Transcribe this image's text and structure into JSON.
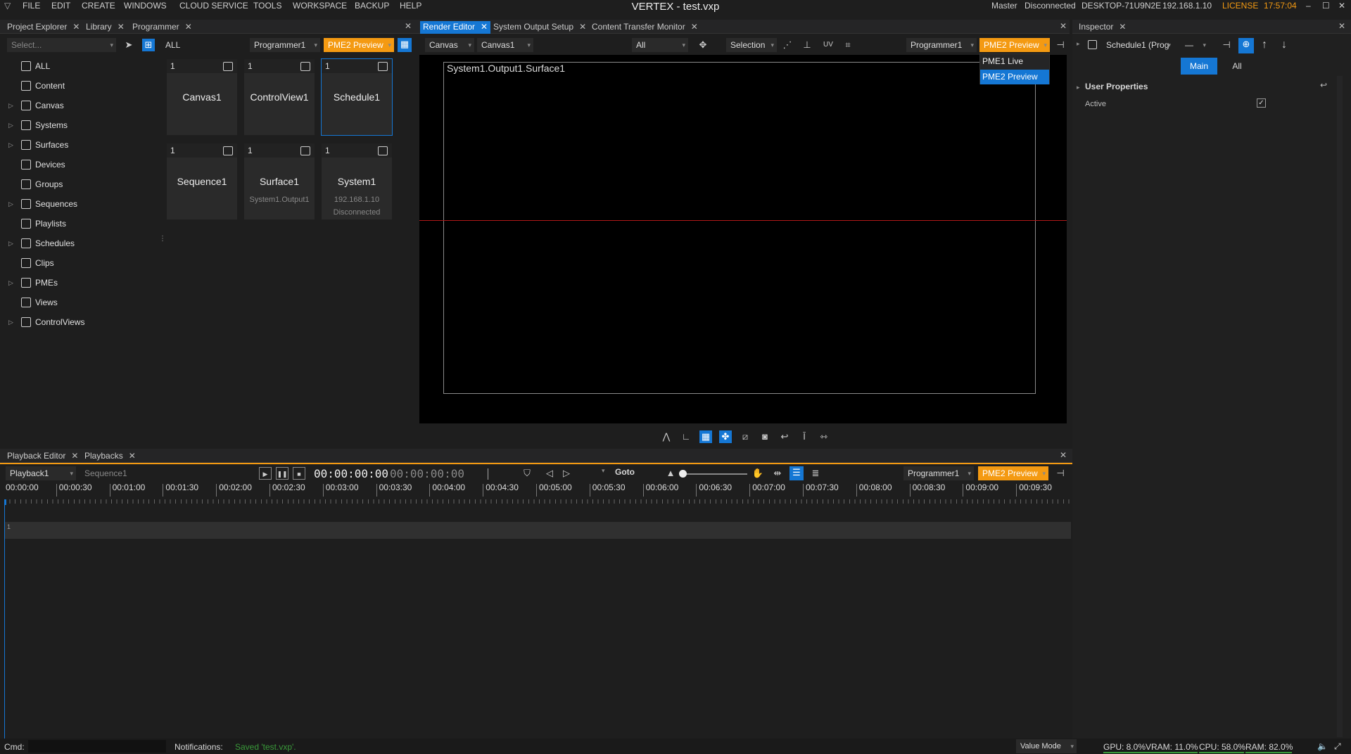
{
  "menubar": {
    "items": [
      "FILE",
      "EDIT",
      "CREATE",
      "WINDOWS",
      "CLOUD SERVICE",
      "TOOLS",
      "WORKSPACE",
      "BACKUP",
      "HELP"
    ],
    "title": "VERTEX - test.vxp",
    "status": [
      "Master",
      "Disconnected",
      "DESKTOP-71U9N2E",
      "192.168.1.10"
    ],
    "license": "LICENSE",
    "clock": "17:57:04"
  },
  "left_tabs": [
    "Project Explorer",
    "Library",
    "Programmer"
  ],
  "project_explorer": {
    "select_placeholder": "Select...",
    "tree": [
      {
        "label": "ALL",
        "expandable": false
      },
      {
        "label": "Content",
        "expandable": false
      },
      {
        "label": "Canvas",
        "expandable": true
      },
      {
        "label": "Systems",
        "expandable": true
      },
      {
        "label": "Surfaces",
        "expandable": true
      },
      {
        "label": "Devices",
        "expandable": false
      },
      {
        "label": "Groups",
        "expandable": false
      },
      {
        "label": "Sequences",
        "expandable": true
      },
      {
        "label": "Playlists",
        "expandable": false
      },
      {
        "label": "Schedules",
        "expandable": true
      },
      {
        "label": "Clips",
        "expandable": false
      },
      {
        "label": "PMEs",
        "expandable": true
      },
      {
        "label": "Views",
        "expandable": false
      },
      {
        "label": "ControlViews",
        "expandable": true
      }
    ]
  },
  "programmer": {
    "filter": "ALL",
    "programmer_select": "Programmer1",
    "pme_select": "PME2 Preview",
    "tiles": [
      {
        "num": "1",
        "name": "Canvas1",
        "sub": "",
        "sub2": "",
        "icon": "canvas-icon"
      },
      {
        "num": "1",
        "name": "ControlView1",
        "sub": "",
        "sub2": "",
        "icon": "sliders-icon"
      },
      {
        "num": "1",
        "name": "Schedule1",
        "sub": "",
        "sub2": "",
        "icon": "calendar-icon"
      },
      {
        "num": "1",
        "name": "Sequence1",
        "sub": "",
        "sub2": "",
        "icon": "sequence-icon"
      },
      {
        "num": "1",
        "name": "Surface1",
        "sub": "System1.Output1",
        "sub2": "",
        "icon": "surface-icon"
      },
      {
        "num": "1",
        "name": "System1",
        "sub": "192.168.1.10",
        "sub2": "Disconnected",
        "icon": "server-icon"
      }
    ]
  },
  "center_tabs": [
    "Render Editor",
    "System Output Setup",
    "Content Transfer Monitor"
  ],
  "render_editor": {
    "canvas_type": "Canvas",
    "canvas_select": "Canvas1",
    "filter_select": "All",
    "selection_select": "Selection",
    "programmer_select": "Programmer1",
    "pme_select": "PME2 Preview",
    "pme_options": [
      "PME1 Live",
      "PME2 Preview"
    ],
    "surface_label": "System1.Output1.Surface1"
  },
  "inspector": {
    "tab": "Inspector",
    "object": "Schedule1 (Prog",
    "minus": "—",
    "main_tab": "Main",
    "all_tab": "All",
    "section": "User Properties",
    "prop_active": "Active"
  },
  "bottom_tabs": [
    "Playback Editor",
    "Playbacks"
  ],
  "playback": {
    "playback_select": "Playback1",
    "sequence_select": "Sequence1",
    "time_current": "00:00:00:00",
    "time_total": "00:00:00:00",
    "goto": "Goto",
    "programmer_select": "Programmer1",
    "pme_select": "PME2 Preview",
    "ruler": [
      "00:00:00",
      "00:00:30",
      "00:01:00",
      "00:01:30",
      "00:02:00",
      "00:02:30",
      "00:03:00",
      "00:03:30",
      "00:04:00",
      "00:04:30",
      "00:05:00",
      "00:05:30",
      "00:06:00",
      "00:06:30",
      "00:07:00",
      "00:07:30",
      "00:08:00",
      "00:08:30",
      "00:09:00",
      "00:09:30"
    ],
    "track_num": "1"
  },
  "statusbar": {
    "cmd": "Cmd:",
    "notifications": "Notifications:",
    "notification_msg": "Saved 'test.vxp'.",
    "mode": "Value Mode",
    "gpu": "GPU: 8.0%",
    "vram": "VRAM: 11.0%",
    "cpu": "CPU: 58.0%",
    "ram": "RAM: 82.0%"
  },
  "colors": {
    "accent": "#1577d4",
    "preview": "#f49a12",
    "notify": "#3a9a3a"
  }
}
